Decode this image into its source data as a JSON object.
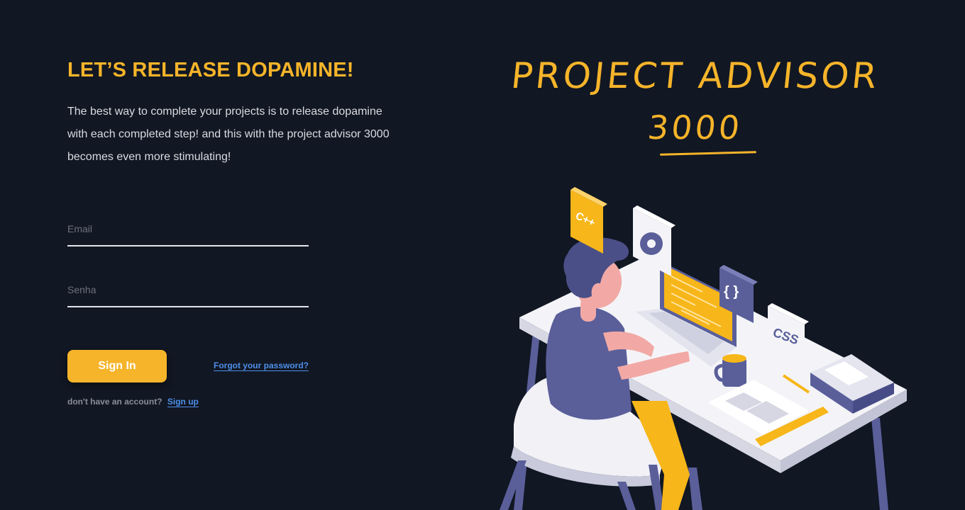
{
  "headline": "LET’S RELEASE DOPAMINE!",
  "intro": "The best way to complete your projects is to release dopamine with each completed step! and this with the project advisor 3000 becomes even more stimulating!",
  "form": {
    "email_placeholder": "Email",
    "password_placeholder": "Senha",
    "signin_label": "Sign In",
    "forgot_label": "Forgot your password?",
    "no_account_text": "don't have an account?",
    "signup_label": "Sign up"
  },
  "brand": {
    "line1": "PROJECT ADVISOR",
    "line2": "3000"
  },
  "illustration": {
    "tiles": [
      "C++",
      "CSS",
      "{ }"
    ]
  },
  "colors": {
    "background": "#111723",
    "accent": "#f5b42a",
    "link": "#4e8fe8",
    "text": "#d9dbe0"
  }
}
